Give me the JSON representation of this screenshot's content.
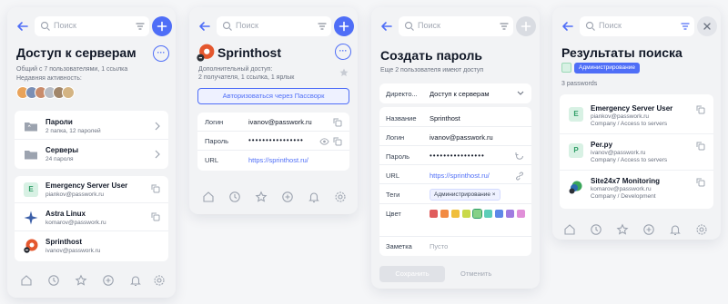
{
  "colors": {
    "accent": "#4f6ef7",
    "green": "#2f9e67",
    "text": "#111827",
    "muted": "#6b7280"
  },
  "search": {
    "placeholder": "Поиск"
  },
  "panel1": {
    "title": "Доступ к серверам",
    "info_line1": "Общий с 7 пользователями, 1 ссылка",
    "info_line2": "Недавняя активность:",
    "folders": [
      {
        "name": "Пароли",
        "meta": "2 папка, 12 паролей",
        "icon": "folder-icon"
      },
      {
        "name": "Серверы",
        "meta": "24 пароля",
        "icon": "folder-icon"
      }
    ],
    "items": [
      {
        "name": "Emergency Server User",
        "login": "piankov@passwork.ru",
        "letter": "E"
      },
      {
        "name": "Astra Linux",
        "login": "komarov@passwork.ru"
      },
      {
        "name": "Sprinthost",
        "login": "ivanov@passwork.ru"
      }
    ]
  },
  "panel2": {
    "title": "Sprinthost",
    "access_label": "Дополнительный доступ:",
    "access_detail": "2 получателя, 1 ссылка, 1 ярлык",
    "auth_button": "Авторизоваться через Пассворк",
    "fields": [
      {
        "label": "Логин",
        "value": "ivanov@passwork.ru"
      },
      {
        "label": "Пароль",
        "value": "••••••••••••••••"
      },
      {
        "label": "URL",
        "value": "https://sprinthost.ru/"
      }
    ]
  },
  "panel3": {
    "title": "Создать пароль",
    "subtitle": "Еще 2 пользователя имеют доступ",
    "directory_label": "Директо...",
    "directory_value": "Доступ к серверам",
    "fields": [
      {
        "label": "Название",
        "value": "Sprinthost"
      },
      {
        "label": "Логин",
        "value": "ivanov@passwork.ru"
      },
      {
        "label": "Пароль",
        "value": "••••••••••••••••"
      },
      {
        "label": "URL",
        "value": "https://sprinthost.ru/"
      }
    ],
    "tags_label": "Теги",
    "tag_value": "Администрирование",
    "color_label": "Цвет",
    "swatches": [
      "#e05d5d",
      "#f28b43",
      "#f0bf3c",
      "#c9d94a",
      "#86d187",
      "#5ccdb8",
      "#5d88e8",
      "#9f7be0",
      "#e08fd8"
    ],
    "note_label": "Заметка",
    "note_placeholder": "Пусто",
    "save_label": "Сохранить",
    "cancel_label": "Отменить"
  },
  "panel4": {
    "title": "Результаты поиска",
    "filter_badge": "Администрирование",
    "count_text": "3 passwords",
    "results": [
      {
        "name": "Emergency Server User",
        "login": "piankov@passwork.ru",
        "path": "Company / Access to servers",
        "letter": "E"
      },
      {
        "name": "Per.py",
        "login": "ivanov@passwork.ru",
        "path": "Company / Access to servers",
        "letter": "P"
      },
      {
        "name": "Site24x7 Monitoring",
        "login": "komarov@passwork.ru",
        "path": "Company / Development"
      }
    ]
  }
}
